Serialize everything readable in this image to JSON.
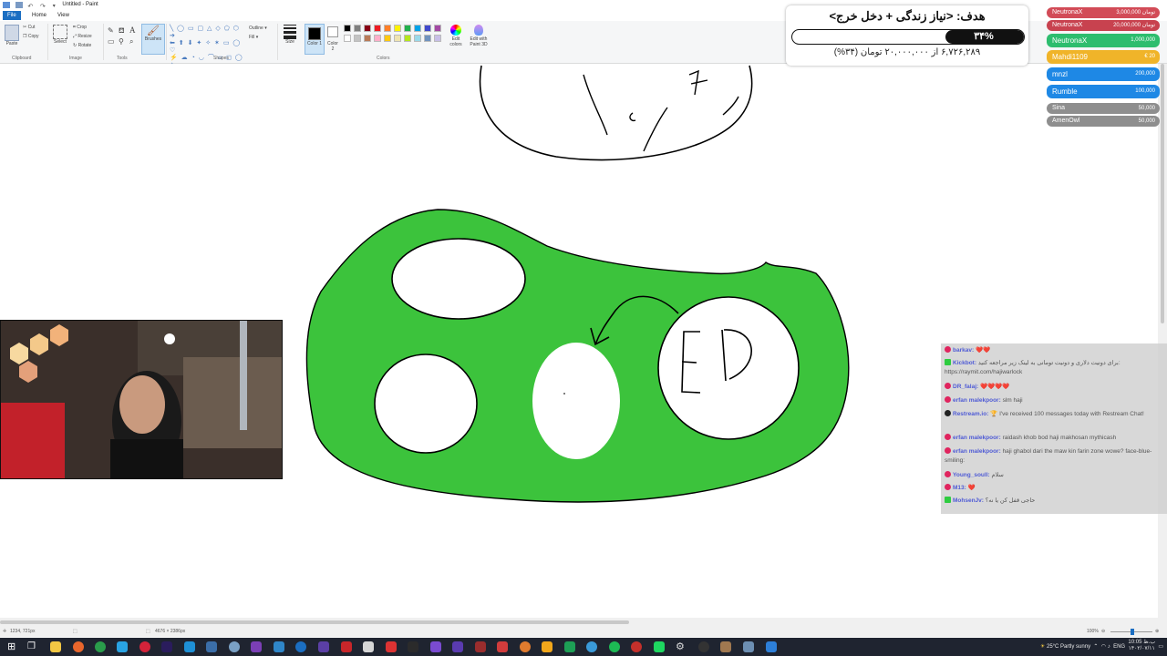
{
  "window": {
    "title": "Untitled - Paint"
  },
  "menu": {
    "tabs": [
      "File",
      "Home",
      "View"
    ]
  },
  "ribbon": {
    "clipboard": {
      "paste": "Paste",
      "cut": "Cut",
      "copy": "Copy",
      "label": "Clipboard"
    },
    "image": {
      "select": "Select",
      "crop": "Crop",
      "resize": "Resize",
      "rotate": "Rotate",
      "label": "Image"
    },
    "tools": {
      "label": "Tools",
      "brushes": "Brushes"
    },
    "shapes": {
      "outline": "Outline",
      "fill": "Fill",
      "label": "Shapes"
    },
    "size": {
      "label": "Size"
    },
    "colors": {
      "color1": "Color 1",
      "color2": "Color 2",
      "edit_colors": "Edit colors",
      "paint3d": "Edit with Paint 3D",
      "label": "Colors",
      "palette": [
        "#000000",
        "#7f7f7f",
        "#880015",
        "#ed1c24",
        "#ff7f27",
        "#fff200",
        "#22b14c",
        "#00a2e8",
        "#3f48cc",
        "#a349a4",
        "#ffffff",
        "#c3c3c3",
        "#b97a57",
        "#ffaec9",
        "#ffc90e",
        "#efe4b0",
        "#b5e61d",
        "#99d9ea",
        "#7092be",
        "#c8bfe7"
      ]
    }
  },
  "canvas": {
    "drawing_text": "ED",
    "blob_color": "#3cc33c"
  },
  "goal": {
    "title": "هدف: <نیاز زندگی + دخل خرج>",
    "percent": "۳۴%",
    "fraction": 0.34,
    "subtitle": "۶,۷۲۶,۲۸۹ از ۲۰,۰۰۰,۰۰۰ تومان (۳۴%)"
  },
  "leaderboard": [
    {
      "name": "NeutronaX",
      "amount": "3,000,000 تومان",
      "color": "#d24b57"
    },
    {
      "name": "NeutronaX",
      "amount": "20,000,000 تومان",
      "color": "#c8424f"
    },
    {
      "name": "NeutronaX",
      "amount": "1,000,000",
      "color": "#2dbd6e"
    },
    {
      "name": "Mahdi1109",
      "amount": "€ 20",
      "color": "#f0b429"
    },
    {
      "name": "mnzl",
      "amount": "200,000",
      "color": "#1e88e5"
    },
    {
      "name": "Rumble",
      "amount": "100,000",
      "color": "#1e88e5"
    },
    {
      "name": "Sina",
      "amount": "50,000",
      "color": "#8e8e8e"
    },
    {
      "name": "AmenOwl",
      "amount": "50,000",
      "color": "#8e8e8e"
    }
  ],
  "chat": [
    {
      "user": "barkav:",
      "text": "",
      "hearts": "❤️❤️"
    },
    {
      "user": "Kickbot:",
      "text": "برای دونیت دلاری و دونیت تومانی به لینک زیر مراجعه کنید: https://raymit.com/hajiwarlock",
      "hearts": ""
    },
    {
      "user": "DR_falaj:",
      "text": "",
      "hearts": "❤️❤️❤️❤️"
    },
    {
      "user": "erfan malekpoor:",
      "text": "slm haji",
      "hearts": ""
    },
    {
      "user": "Restream.io:",
      "text": "🏆 I've received 100 messages today with Restream Chat!",
      "hearts": ""
    },
    {
      "user": "erfan malekpoor:",
      "text": "raidash khob bod haji makhosan mythicash",
      "hearts": ""
    },
    {
      "user": "erfan malekpoor:",
      "text": "haji ghabol dari the maw kin farin zone wowe? face-blue-smiling:",
      "hearts": ""
    },
    {
      "user": "Young_soull:",
      "text": "سلام",
      "hearts": ""
    },
    {
      "user": "M13:",
      "text": "",
      "hearts": "❤️"
    },
    {
      "user": "MohsenJv:",
      "text": "حاجی قفل کن یا نه؟",
      "hearts": ""
    }
  ],
  "status": {
    "cursor": "1234, 721px",
    "size": "4676 × 2386px",
    "zoom": "100%"
  },
  "taskbar": {
    "weather": "25°C  Partly sunny",
    "lang": "ENG",
    "time": "10:05 ب.ظ",
    "date": "۱۴۰۲/۰۷/۱۱"
  }
}
